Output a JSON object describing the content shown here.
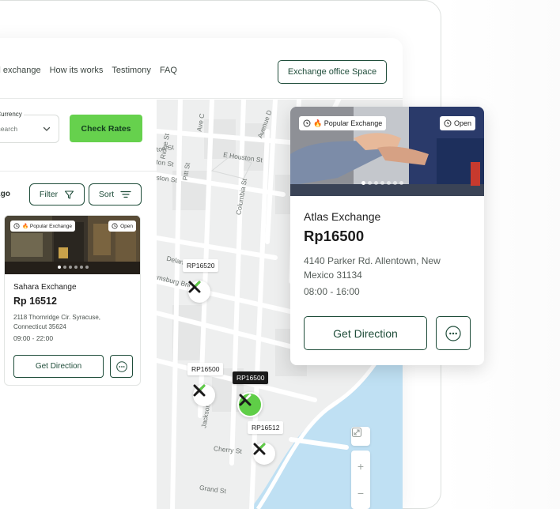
{
  "nav": {
    "links": [
      "obal exchange",
      "How its works",
      "Testimony",
      "FAQ"
    ],
    "cta_label": "Exchange office Space"
  },
  "search": {
    "currency_label": "get Currency",
    "currency_value": "e of search",
    "check_button": "Check Rates"
  },
  "list": {
    "days_ago": "ys Ago",
    "filter_label": "Filter",
    "sort_label": "Sort"
  },
  "small_card": {
    "badge_popular": "🔥 Popular Exchange",
    "badge_open": "Open",
    "name": "Sahara Exchange",
    "rate": "Rp 16512",
    "address": "2118 Thornridge Cir. Syracuse, Connecticut 35624",
    "hours": "09:00 - 22:00",
    "direction_button": "Get Direction"
  },
  "map": {
    "streets": [
      "Houston St",
      "Ave C",
      "Houston St",
      "Stanton St",
      "Ridge St",
      "Pitt St",
      "E Houston St",
      "Columbia St",
      "Avenue D",
      "Delancey St",
      "Willamsburg Bridge",
      "Jackson St",
      "Cherry St",
      "Grand St"
    ],
    "markers": [
      {
        "price": "RP16520",
        "active": false
      },
      {
        "price": "RP16500",
        "active": false
      },
      {
        "price": "RP16500",
        "active": true
      },
      {
        "price": "RP16512",
        "active": false
      }
    ],
    "zoom_in": "+",
    "zoom_out": "−"
  },
  "large_card": {
    "badge_popular": "🔥 Popular Exchange",
    "badge_open": "Open",
    "name": "Atlas Exchange",
    "rate": "Rp16500",
    "address": "4140 Parker Rd. Allentown, New Mexico 31134",
    "hours": "08:00 - 16:00",
    "direction_button": "Get Direction"
  },
  "colors": {
    "brand_dark": "#1f4d3a",
    "accent_green": "#66d14d",
    "water": "#bfe0f3"
  }
}
